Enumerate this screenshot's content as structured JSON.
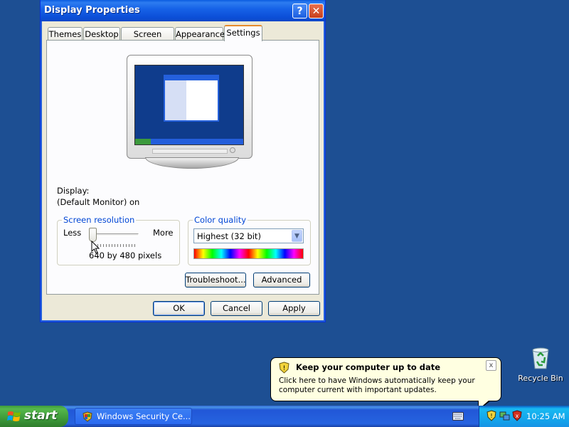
{
  "window": {
    "title": "Display Properties",
    "help_btn": "?",
    "close_btn": "✕",
    "tabs": [
      {
        "label": "Themes"
      },
      {
        "label": "Desktop"
      },
      {
        "label": "Screen Saver"
      },
      {
        "label": "Appearance"
      },
      {
        "label": "Settings",
        "active": true
      }
    ],
    "display_label": "Display:",
    "display_value": "(Default Monitor) on",
    "resolution": {
      "legend": "Screen resolution",
      "less": "Less",
      "more": "More",
      "value": "640 by 480 pixels"
    },
    "color_quality": {
      "legend": "Color quality",
      "selected": "Highest (32 bit)"
    },
    "buttons": {
      "troubleshoot": "Troubleshoot...",
      "advanced": "Advanced",
      "ok": "OK",
      "cancel": "Cancel",
      "apply": "Apply"
    }
  },
  "desktop": {
    "recycle_bin": "Recycle Bin"
  },
  "balloon": {
    "title": "Keep your computer up to date",
    "text": "Click here to have Windows automatically keep your computer current with important updates.",
    "close": "x"
  },
  "taskbar": {
    "start": "start",
    "task": "Windows Security Ce...",
    "clock": "10:25 AM"
  },
  "colors": {
    "desktop": "#1d4f93",
    "title_bar": "#0c4fd8",
    "dialog_bg": "#ece9d8",
    "balloon_bg": "#ffffe1",
    "start_green": "#3d9a3a"
  }
}
